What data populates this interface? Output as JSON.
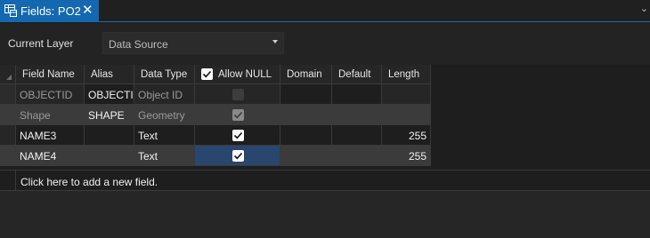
{
  "tab": {
    "title": "Fields:  PO2",
    "close": "✕",
    "menu_caret": "⌄"
  },
  "layer": {
    "label": "Current Layer",
    "selected": "Data Source"
  },
  "columns": [
    "Field Name",
    "Alias",
    "Data Type",
    "Allow NULL",
    "Domain",
    "Default",
    "Length"
  ],
  "rows": [
    {
      "field_name": "OBJECTID",
      "alias": "OBJECTID",
      "data_type": "Object ID",
      "allow_null": false,
      "domain": "",
      "default": "",
      "length": ""
    },
    {
      "field_name": "Shape",
      "alias": "SHAPE",
      "data_type": "Geometry",
      "allow_null": true,
      "domain": "",
      "default": "",
      "length": ""
    },
    {
      "field_name": "NAME3",
      "alias": "",
      "data_type": "Text",
      "allow_null": true,
      "domain": "",
      "default": "",
      "length": "255"
    },
    {
      "field_name": "NAME4",
      "alias": "",
      "data_type": "Text",
      "allow_null": true,
      "domain": "",
      "default": "",
      "length": "255"
    }
  ],
  "add_field_text": "Click here to add a new field.",
  "colors": {
    "accent": "#1468b0",
    "selected_cell": "#29476e"
  }
}
